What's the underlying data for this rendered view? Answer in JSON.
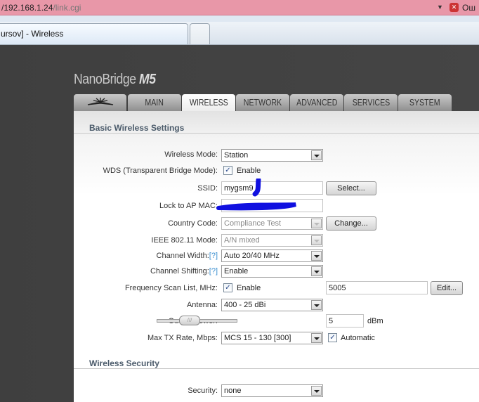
{
  "browser": {
    "url_host": "/192.168.1.24",
    "url_path": "/link.cgi",
    "error_label": "Ош",
    "tab_title": "ursov] - Wireless"
  },
  "product": {
    "name": "NanoBridge",
    "model": "M5"
  },
  "nav": {
    "tabs": [
      {
        "label": "MAIN"
      },
      {
        "label": "WIRELESS",
        "active": true
      },
      {
        "label": "NETWORK"
      },
      {
        "label": "ADVANCED"
      },
      {
        "label": "SERVICES"
      },
      {
        "label": "SYSTEM"
      }
    ]
  },
  "basic": {
    "title": "Basic Wireless Settings",
    "wireless_mode": {
      "label": "Wireless Mode:",
      "value": "Station"
    },
    "wds": {
      "label": "WDS (Transparent Bridge Mode):",
      "checked": true,
      "text": "Enable"
    },
    "ssid": {
      "label": "SSID:",
      "value": "mygsm9",
      "button": "Select..."
    },
    "lock_ap_mac": {
      "label": "Lock to AP MAC:"
    },
    "country": {
      "label": "Country Code:",
      "value": "Compliance Test",
      "button": "Change..."
    },
    "ieee_mode": {
      "label": "IEEE 802.11 Mode:",
      "value": "A/N mixed"
    },
    "channel_width": {
      "label": "Channel Width:",
      "help": "[?]",
      "value": "Auto 20/40 MHz"
    },
    "channel_shifting": {
      "label": "Channel Shifting:",
      "help": "[?]",
      "value": "Enable"
    },
    "freq_scan": {
      "label": "Frequency Scan List, MHz:",
      "checked": true,
      "text": "Enable",
      "value": "5005",
      "button": "Edit..."
    },
    "antenna": {
      "label": "Antenna:",
      "value": "400 - 25 dBi"
    },
    "output_power": {
      "label": "Output Power:",
      "value": "5",
      "unit": "dBm"
    },
    "max_tx": {
      "label": "Max TX Rate, Mbps:",
      "value": "MCS 15 - 130 [300]",
      "auto_checked": true,
      "auto_text": "Automatic"
    }
  },
  "security": {
    "title": "Wireless Security",
    "security": {
      "label": "Security:",
      "value": "none"
    }
  }
}
